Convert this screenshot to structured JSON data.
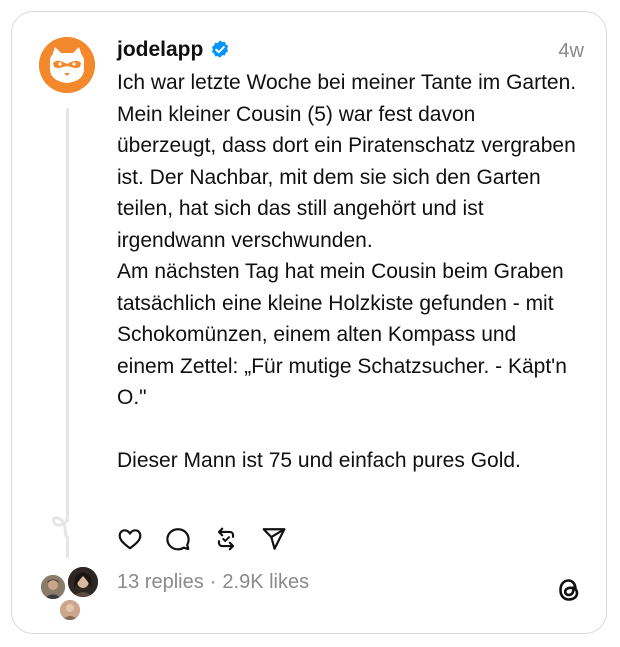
{
  "post": {
    "username": "jodelapp",
    "verified": true,
    "time": "4w",
    "lines": [
      "Ich war letzte Woche bei meiner Tante im Garten.",
      "Mein kleiner Cousin (5) war fest davon überzeugt, dass dort ein Piratenschatz vergraben ist. Der Nachbar, mit dem sie sich den Garten teilen, hat sich das still angehört und ist irgendwann verschwunden.",
      "Am nächsten Tag hat mein Cousin beim Graben tatsächlich eine kleine Holzkiste gefunden - mit Schokomünzen, einem alten Kompass und einem Zettel: „Für mutige Schatzsucher. - Käpt'n O.\"",
      "",
      "Dieser Mann ist 75 und einfach pures Gold."
    ]
  },
  "actions": {
    "like": "heart-icon",
    "reply": "comment-icon",
    "repost": "repost-icon",
    "share": "send-icon"
  },
  "stats": {
    "replies": "13 replies",
    "separator": "·",
    "likes": "2.9K likes"
  },
  "colors": {
    "avatar_bg": "#f4882c",
    "verified_blue": "#0095f6",
    "muted_text": "#8a8a8a",
    "thread_line": "#e6e6e6"
  }
}
